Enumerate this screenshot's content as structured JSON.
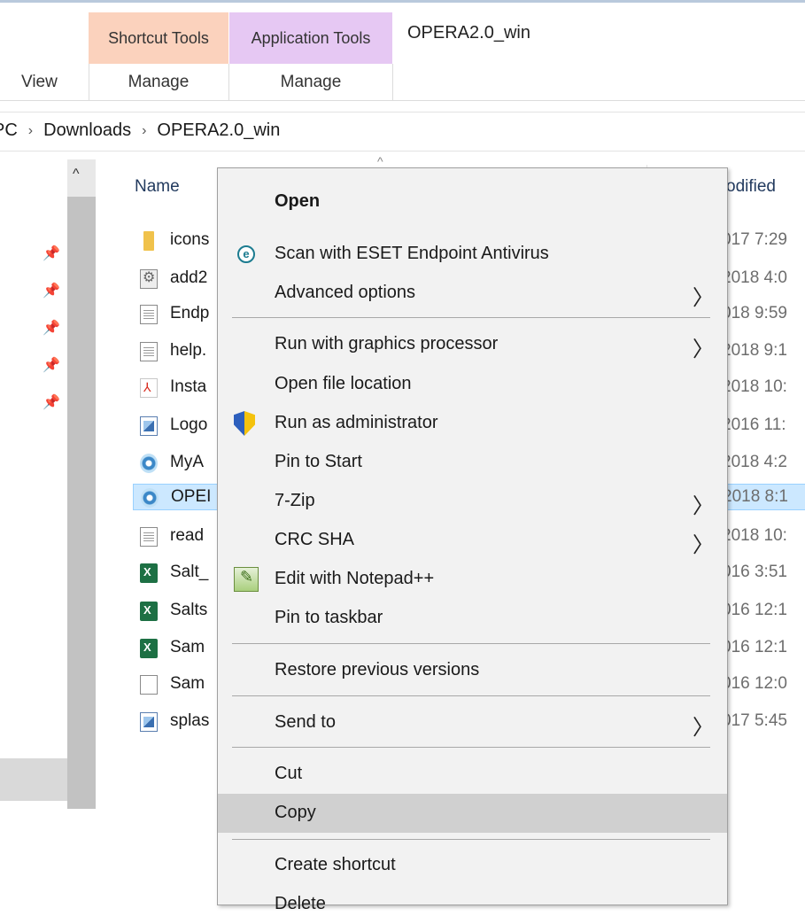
{
  "window": {
    "title": "OPERA2.0_win"
  },
  "ribbon": {
    "contextual_tabs": [
      {
        "label": "Shortcut Tools",
        "color": "#fbd2bd"
      },
      {
        "label": "Application Tools",
        "color": "#e6c8f3"
      }
    ],
    "tabs": {
      "view": "View",
      "manage_1": "Manage",
      "manage_2": "Manage"
    }
  },
  "address_bar": {
    "crumbs": [
      "PC",
      "Downloads",
      "OPERA2.0_win"
    ],
    "separator": "›"
  },
  "nav_pane": {
    "scroll_up": "^",
    "pin_icon": "📌"
  },
  "file_list": {
    "columns": {
      "name": "Name",
      "modified": "odified",
      "sort_caret": "^"
    },
    "rows": [
      {
        "name": "icons",
        "date": "017 7:29",
        "icon": "folder-icon",
        "selected": false
      },
      {
        "name": "add2",
        "date": "2018 4:0",
        "icon": "installer-gear-icon",
        "selected": false
      },
      {
        "name": "Endp",
        "date": "018 9:59",
        "icon": "text-document-icon",
        "selected": false
      },
      {
        "name": "help.",
        "date": "2018 9:1",
        "icon": "text-document-icon",
        "selected": false
      },
      {
        "name": "Insta",
        "date": "2018 10:",
        "icon": "pdf-icon",
        "selected": false
      },
      {
        "name": "Logo",
        "date": "2016 11:",
        "icon": "image-icon",
        "selected": false
      },
      {
        "name": "MyA",
        "date": "2018 4:2",
        "icon": "app-icon",
        "selected": false
      },
      {
        "name": "OPEI",
        "date": "2018 8:1",
        "icon": "app-shortcut-icon",
        "selected": true
      },
      {
        "name": "read",
        "date": "2018 10:",
        "icon": "text-document-icon",
        "selected": false
      },
      {
        "name": "Salt_",
        "date": "016 3:51",
        "icon": "excel-icon",
        "selected": false
      },
      {
        "name": "Salts",
        "date": "016 12:1",
        "icon": "excel-icon",
        "selected": false
      },
      {
        "name": "Sam",
        "date": "016 12:1",
        "icon": "excel-icon",
        "selected": false
      },
      {
        "name": "Sam",
        "date": "016 12:0",
        "icon": "blank-file-icon",
        "selected": false
      },
      {
        "name": "splas",
        "date": "017 5:45",
        "icon": "image-icon",
        "selected": false
      }
    ]
  },
  "context_menu": {
    "items": {
      "open": "Open",
      "scan": "Scan with ESET Endpoint Antivirus",
      "advanced": "Advanced options",
      "run_gpu": "Run with graphics processor",
      "open_location": "Open file location",
      "run_admin": "Run as administrator",
      "pin_start": "Pin to Start",
      "seven_zip": "7-Zip",
      "crc_sha": "CRC SHA",
      "notepad": "Edit with Notepad++",
      "pin_taskbar": "Pin to taskbar",
      "restore": "Restore previous versions",
      "send_to": "Send to",
      "cut": "Cut",
      "copy": "Copy",
      "create_shortcut": "Create shortcut",
      "delete": "Delete"
    },
    "submenu_arrow": "〉",
    "eset_glyph": "e",
    "hovered_item": "Copy"
  }
}
